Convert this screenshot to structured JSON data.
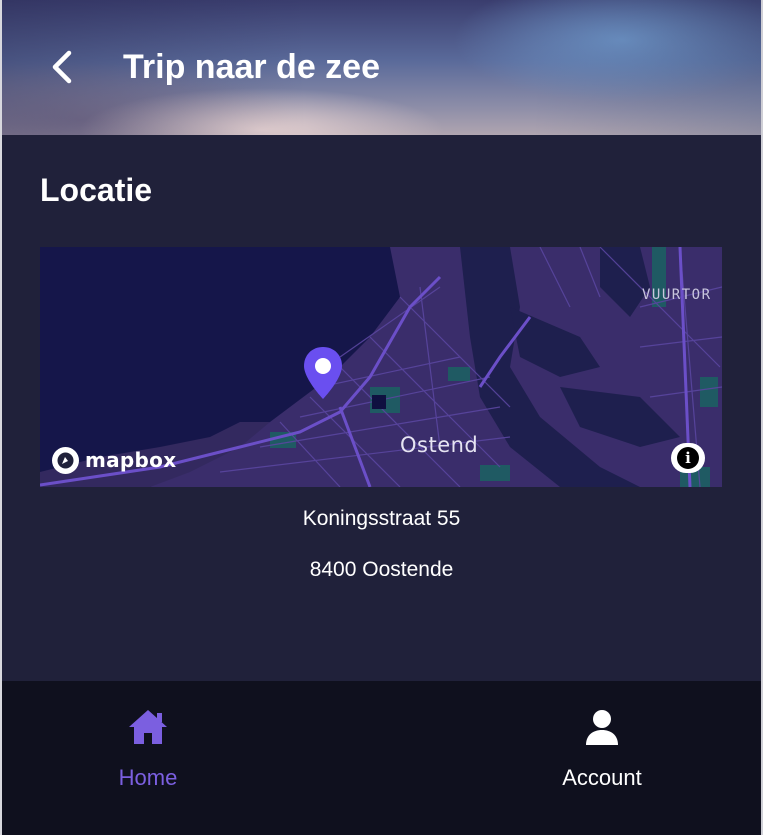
{
  "header": {
    "title": "Trip naar de zee",
    "back_icon": "chevron-left-icon"
  },
  "location": {
    "section_title": "Locatie",
    "map": {
      "city_label": "Ostend",
      "poi_label": "VUURTOR",
      "attribution_logo": "mapbox",
      "info_icon": "info-icon",
      "marker_color": "#6a4ff0"
    },
    "address": {
      "street": "Koningsstraat 55",
      "city": "8400 Oostende"
    }
  },
  "bottom_nav": {
    "items": [
      {
        "label": "Home",
        "icon": "home-icon",
        "active": true
      },
      {
        "label": "Account",
        "icon": "user-icon",
        "active": false
      }
    ]
  },
  "colors": {
    "background": "#20213a",
    "nav_background": "#0f101e",
    "accent": "#7b5fe0",
    "map_background": "#15164a"
  }
}
